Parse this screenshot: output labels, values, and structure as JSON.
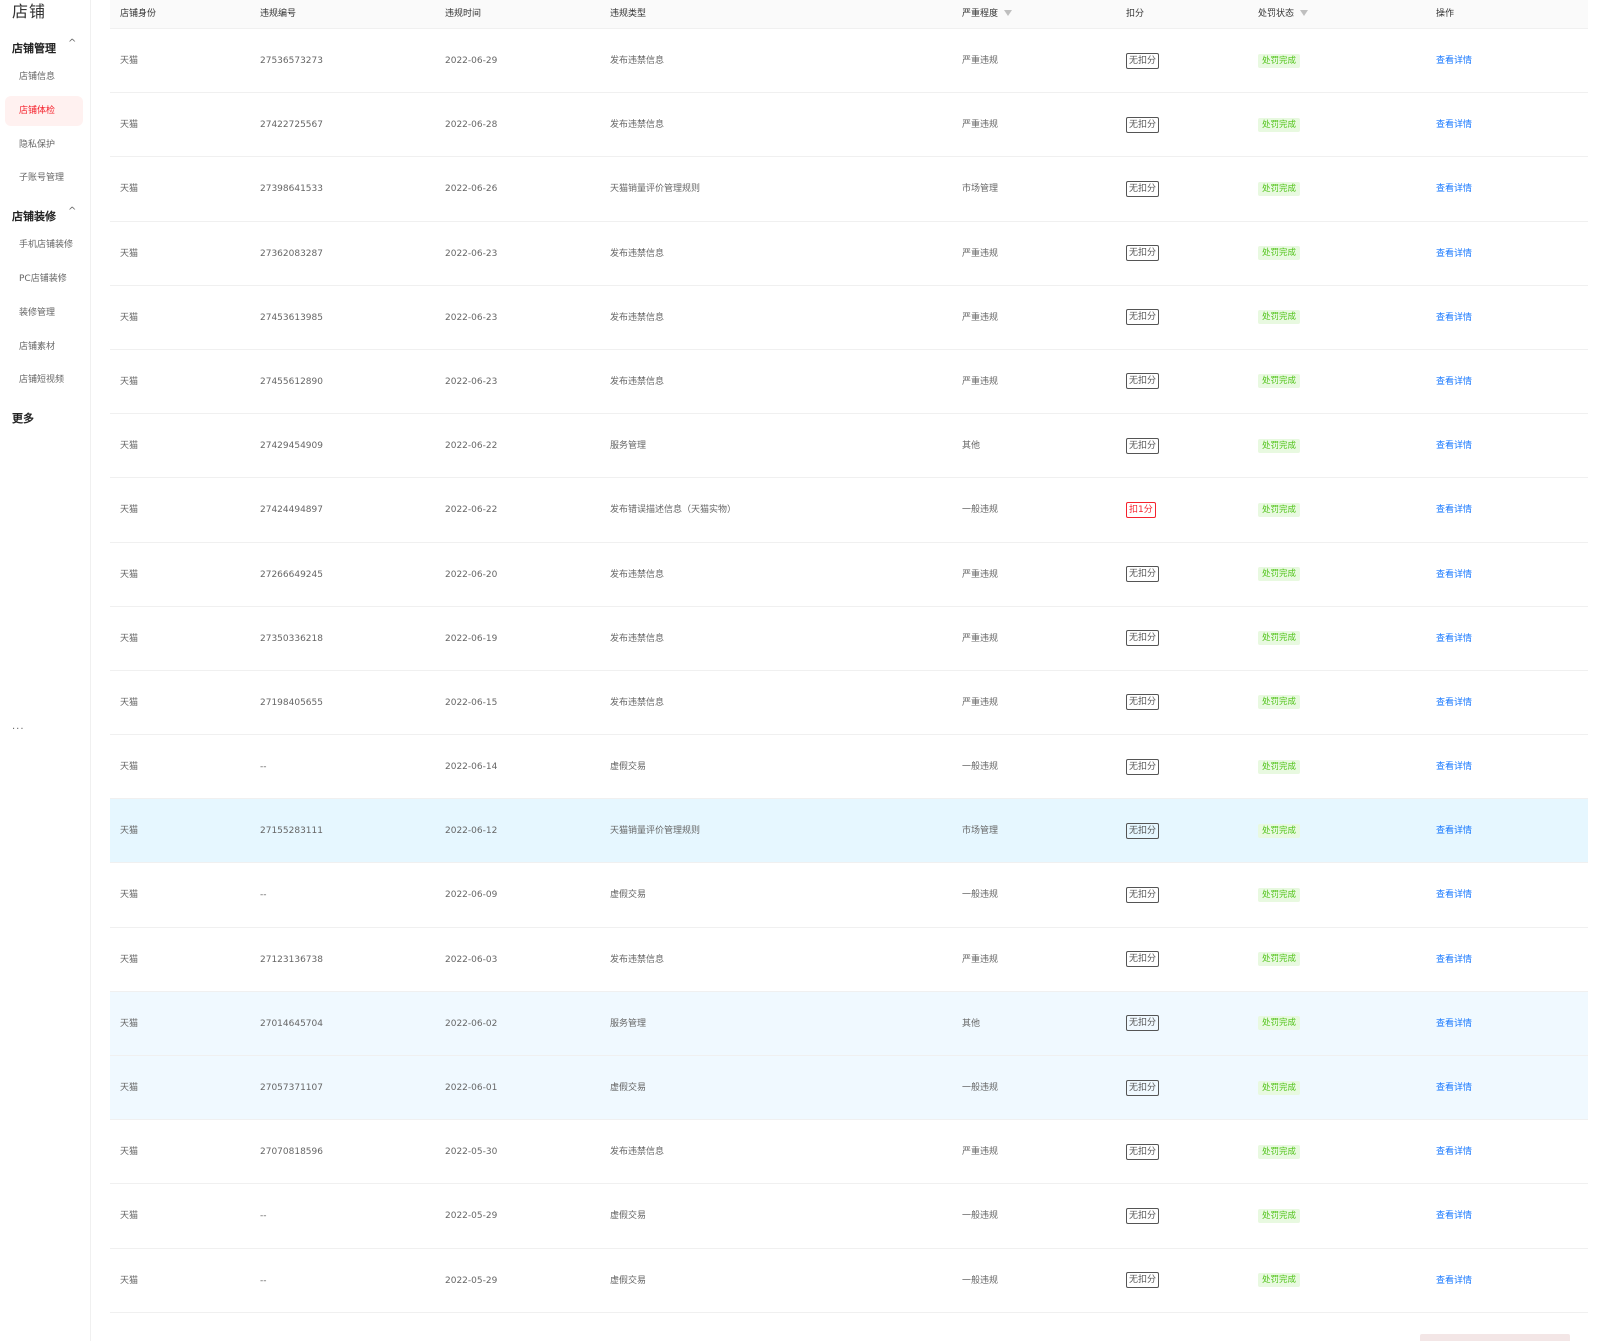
{
  "sidebar": {
    "title": "店铺",
    "groups": [
      {
        "label": "店铺管理",
        "chevron": "^",
        "items": [
          {
            "label": "店铺信息",
            "active": false
          },
          {
            "label": "店铺体检",
            "active": true
          },
          {
            "label": "隐私保护",
            "active": false
          },
          {
            "label": "子账号管理",
            "active": false
          }
        ]
      },
      {
        "label": "店铺装修",
        "chevron": "^",
        "items": [
          {
            "label": "手机店铺装修",
            "active": false
          },
          {
            "label": "PC店铺装修",
            "active": false
          },
          {
            "label": "装修管理",
            "active": false
          },
          {
            "label": "店铺素材",
            "active": false
          },
          {
            "label": "店铺短视频",
            "active": false
          }
        ]
      }
    ],
    "more": "更多",
    "dots": "···"
  },
  "table": {
    "columns": [
      "店铺身份",
      "违规编号",
      "违规时间",
      "违规类型",
      "严重程度",
      "扣分",
      "处罚状态",
      "操作"
    ],
    "filter_icon": "filter-icon",
    "link_text": "查看详情",
    "rows": [
      [
        "天猫",
        "27536573273",
        "2022-06-29",
        "发布违禁信息",
        "严重违规",
        "无扣分",
        "处罚完成"
      ],
      [
        "天猫",
        "27422725567",
        "2022-06-28",
        "发布违禁信息",
        "严重违规",
        "无扣分",
        "处罚完成"
      ],
      [
        "天猫",
        "27398641533",
        "2022-06-26",
        "天猫销量评价管理规则",
        "市场管理",
        "无扣分",
        "处罚完成"
      ],
      [
        "天猫",
        "27362083287",
        "2022-06-23",
        "发布违禁信息",
        "严重违规",
        "无扣分",
        "处罚完成"
      ],
      [
        "天猫",
        "27453613985",
        "2022-06-23",
        "发布违禁信息",
        "严重违规",
        "无扣分",
        "处罚完成"
      ],
      [
        "天猫",
        "27455612890",
        "2022-06-23",
        "发布违禁信息",
        "严重违规",
        "无扣分",
        "处罚完成"
      ],
      [
        "天猫",
        "27429454909",
        "2022-06-22",
        "服务管理",
        "其他",
        "无扣分",
        "处罚完成"
      ],
      [
        "天猫",
        "27424494897",
        "2022-06-22",
        "发布错误描述信息（天猫实物）",
        "一般违规",
        "扣1分",
        "处罚完成"
      ],
      [
        "天猫",
        "27266649245",
        "2022-06-20",
        "发布违禁信息",
        "严重违规",
        "无扣分",
        "处罚完成"
      ],
      [
        "天猫",
        "27350336218",
        "2022-06-19",
        "发布违禁信息",
        "严重违规",
        "无扣分",
        "处罚完成"
      ],
      [
        "天猫",
        "27198405655",
        "2022-06-15",
        "发布违禁信息",
        "严重违规",
        "无扣分",
        "处罚完成"
      ],
      [
        "天猫",
        "--",
        "2022-06-14",
        "虚假交易",
        "一般违规",
        "无扣分",
        "处罚完成"
      ],
      [
        "天猫",
        "27155283111",
        "2022-06-12",
        "天猫销量评价管理规则",
        "市场管理",
        "无扣分",
        "处罚完成"
      ],
      [
        "天猫",
        "--",
        "2022-06-09",
        "虚假交易",
        "一般违规",
        "无扣分",
        "处罚完成"
      ],
      [
        "天猫",
        "27123136738",
        "2022-06-03",
        "发布违禁信息",
        "严重违规",
        "无扣分",
        "处罚完成"
      ],
      [
        "天猫",
        "27014645704",
        "2022-06-02",
        "服务管理",
        "其他",
        "无扣分",
        "处罚完成"
      ],
      [
        "天猫",
        "27057371107",
        "2022-06-01",
        "虚假交易",
        "一般违规",
        "无扣分",
        "处罚完成"
      ],
      [
        "天猫",
        "27070818596",
        "2022-05-30",
        "发布违禁信息",
        "严重违规",
        "无扣分",
        "处罚完成"
      ],
      [
        "天猫",
        "--",
        "2022-05-29",
        "虚假交易",
        "一般违规",
        "无扣分",
        "处罚完成"
      ],
      [
        "天猫",
        "--",
        "2022-05-29",
        "虚假交易",
        "一般违规",
        "无扣分",
        "处罚完成"
      ]
    ],
    "highlight_rows": [
      12
    ],
    "light_rows": [
      15,
      16
    ]
  },
  "colors": {
    "accent_red": "#f5222d",
    "link_blue": "#1677ff",
    "status_green": "#52c41a",
    "row_highlight": "#e6f7ff"
  }
}
